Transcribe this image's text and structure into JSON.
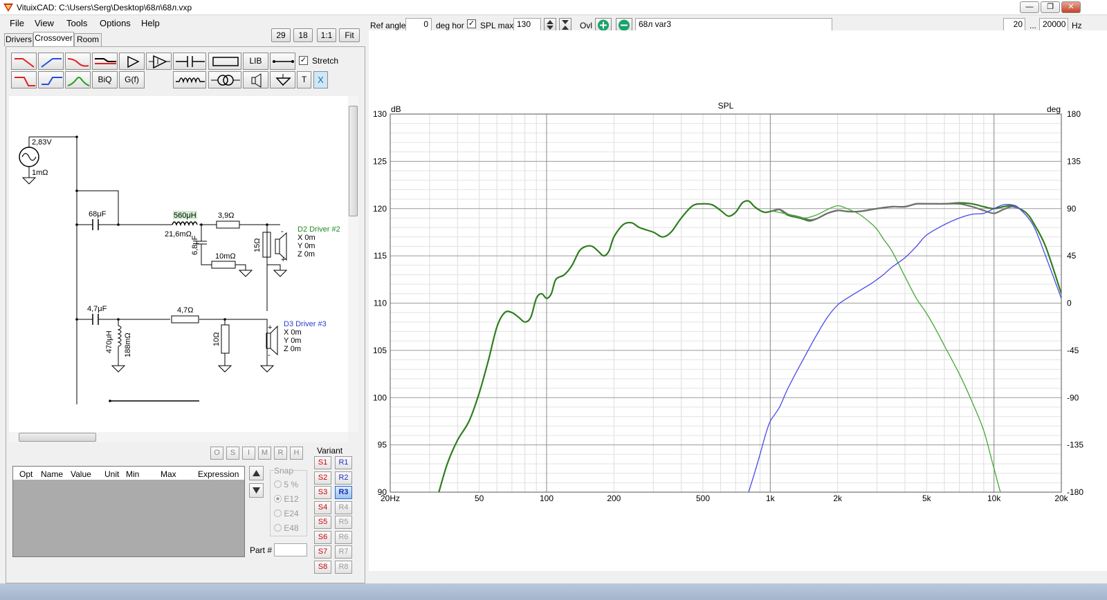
{
  "window": {
    "title": "VituixCAD: C:\\Users\\Serg\\Desktop\\68л\\68л.vxp"
  },
  "menu": [
    "File",
    "View",
    "Tools",
    "Options",
    "Help"
  ],
  "tabs": [
    "Drivers",
    "Crossover",
    "Room"
  ],
  "zoom": {
    "a": "29",
    "b": "18",
    "one": "1:1",
    "fit": "Fit"
  },
  "toolbar": {
    "lib": "LIB",
    "biq": "BiQ",
    "gf": "G(f)",
    "t": "T",
    "x": "X",
    "stretch": "Stretch"
  },
  "schematic": {
    "source_v": "2,83V",
    "source_r": "1mΩ",
    "c1": "68μF",
    "l1": "560μH",
    "l1r": "21,6mΩ",
    "r1": "3,9Ω",
    "c2": "6,8μF",
    "r2": "10mΩ",
    "r3": "15Ω",
    "d2": "D2 Driver #2",
    "d2x": "X 0m",
    "d2y": "Y 0m",
    "d2z": "Z 0m",
    "c3": "4,7μF",
    "l2": "470μH",
    "l2r": "188mΩ",
    "r4": "4,7Ω",
    "r5": "10Ω",
    "d3": "D3 Driver #3",
    "d3x": "X 0m",
    "d3y": "Y 0m",
    "d3z": "Z 0m",
    "plus": "+",
    "minus": "-"
  },
  "opt_buttons": [
    "O",
    "S",
    "I",
    "M",
    "R",
    "H"
  ],
  "table_headers": [
    "Opt",
    "Name",
    "Value",
    "Unit",
    "Min",
    "Max",
    "Expression"
  ],
  "snap": {
    "label": "Snap",
    "options": [
      "5 %",
      "E12",
      "E24",
      "E48"
    ]
  },
  "part_label": "Part #",
  "variant": {
    "label": "Variant",
    "s": [
      "S1",
      "S2",
      "S3",
      "S4",
      "S5",
      "S6",
      "S7",
      "S8"
    ],
    "r": [
      "R1",
      "R2",
      "R3",
      "R4",
      "R5",
      "R6",
      "R7",
      "R8"
    ]
  },
  "controls": {
    "ref_angle_label": "Ref angle",
    "ref_angle": "0",
    "deg_hor": "deg hor",
    "spl_max_label": "SPL max",
    "spl_max": "130",
    "ovl": "Ovl",
    "variant_name": "68л var3",
    "f_min": "20",
    "dots": "...",
    "f_max": "20000",
    "hz": "Hz"
  },
  "chart_data": {
    "type": "line",
    "title": "SPL",
    "ylabel": "dB",
    "y2label": "deg",
    "xscale": "log",
    "xlim": [
      20,
      20000
    ],
    "ylim": [
      90,
      130
    ],
    "y2lim": [
      -180,
      180
    ],
    "xticks": [
      {
        "v": 20,
        "l": "20Hz"
      },
      {
        "v": 50,
        "l": "50"
      },
      {
        "v": 100,
        "l": "100"
      },
      {
        "v": 200,
        "l": "200"
      },
      {
        "v": 500,
        "l": "500"
      },
      {
        "v": 1000,
        "l": "1k"
      },
      {
        "v": 2000,
        "l": "2k"
      },
      {
        "v": 5000,
        "l": "5k"
      },
      {
        "v": 10000,
        "l": "10k"
      },
      {
        "v": 20000,
        "l": "20k"
      }
    ],
    "yticks": [
      90,
      95,
      100,
      105,
      110,
      115,
      120,
      125,
      130
    ],
    "y2ticks": [
      -180,
      -135,
      -90,
      -45,
      0,
      45,
      90,
      135,
      180
    ],
    "series": [
      {
        "color": "#2e7d1e",
        "width": 2.2,
        "x": [
          33,
          36,
          40,
          45,
          50,
          55,
          60,
          65,
          70,
          75,
          80,
          85,
          90,
          95,
          100,
          105,
          110,
          120,
          130,
          140,
          150,
          160,
          170,
          180,
          190,
          200,
          220,
          240,
          260,
          300,
          330,
          360,
          400,
          450,
          500,
          550,
          600,
          650,
          700,
          750,
          800,
          850,
          900,
          950,
          1000,
          1050,
          1100,
          1200,
          1300,
          1400,
          1500,
          1600,
          1700,
          1800,
          2000,
          2200,
          2500,
          3000,
          3500,
          4000,
          4500,
          5000,
          5500,
          6000,
          7000,
          8000,
          9000,
          10000,
          11000,
          12000,
          13000,
          14000,
          15000,
          17000,
          20000
        ],
        "y": [
          90,
          93,
          95.5,
          97.5,
          100.5,
          104,
          107.5,
          109,
          109,
          108.5,
          108,
          108.5,
          110.5,
          111,
          110.5,
          111,
          112.5,
          113,
          114,
          115.5,
          116,
          116,
          115.5,
          115,
          115.5,
          117,
          118.3,
          118.5,
          118,
          117.5,
          117,
          117.5,
          119,
          120.3,
          120.5,
          120.4,
          119.8,
          119.2,
          119.6,
          120.6,
          120.8,
          120.2,
          119.8,
          119.6,
          119.7,
          119.8,
          119.9,
          119.3,
          119.1,
          118.9,
          118.7,
          118.9,
          119.2,
          119.5,
          119.8,
          119.7,
          119.7,
          120,
          120.2,
          120.2,
          120.5,
          120.5,
          120.5,
          120.5,
          120.6,
          120.5,
          120.2,
          120,
          120.2,
          120.3,
          120,
          119.5,
          118.5,
          116,
          111
        ]
      },
      {
        "color": "#707070",
        "width": 2.2,
        "x": [
          1000,
          1100,
          1200,
          1300,
          1400,
          1500,
          1600,
          1700,
          1800,
          2000,
          2200,
          2500,
          3000,
          3500,
          4000,
          4500,
          5000,
          5500,
          6000,
          7000,
          8000,
          9000,
          10000,
          11000,
          12000,
          13000
        ],
        "y": [
          119.7,
          119.9,
          119.4,
          119.2,
          119.0,
          118.8,
          118.9,
          119.2,
          119.5,
          119.8,
          119.7,
          119.7,
          120,
          120.2,
          120.2,
          120.5,
          120.5,
          120.5,
          120.5,
          120.5,
          120.2,
          119.8,
          119.5,
          119.9,
          120.2,
          120.0
        ]
      },
      {
        "color": "#43a832",
        "width": 1.3,
        "x": [
          1000,
          1200,
          1400,
          1600,
          1800,
          2000,
          2200,
          2500,
          2800,
          3000,
          3200,
          3500,
          4000,
          4500,
          5000,
          5500,
          6000,
          7000,
          8000,
          9000,
          10000,
          11000,
          12000
        ],
        "y": [
          119.8,
          119.4,
          119.0,
          119.3,
          119.9,
          120.3,
          120.0,
          119.4,
          118.5,
          117.8,
          116.8,
          115.5,
          112.8,
          110.5,
          108.9,
          107.2,
          105.5,
          102.5,
          99.5,
          96.5,
          92.5,
          89,
          87
        ]
      },
      {
        "color": "#4848e8",
        "width": 1.3,
        "x": [
          800,
          850,
          900,
          950,
          1000,
          1100,
          1200,
          1400,
          1600,
          1800,
          2000,
          2200,
          2500,
          2800,
          3000,
          3200,
          3500,
          4000,
          4500,
          5000,
          6000,
          7000,
          8000,
          9000,
          10000,
          11000,
          12000,
          13000,
          15000,
          17000,
          20000
        ],
        "y": [
          90,
          92,
          94,
          96,
          97.5,
          99,
          101,
          104,
          106.5,
          108.5,
          109.8,
          110.5,
          111.3,
          112,
          112.5,
          113,
          113.8,
          114.8,
          116,
          117.2,
          118.3,
          119,
          119.4,
          119.5,
          120,
          120.4,
          120.4,
          120,
          118.2,
          115,
          110.5
        ]
      }
    ]
  }
}
